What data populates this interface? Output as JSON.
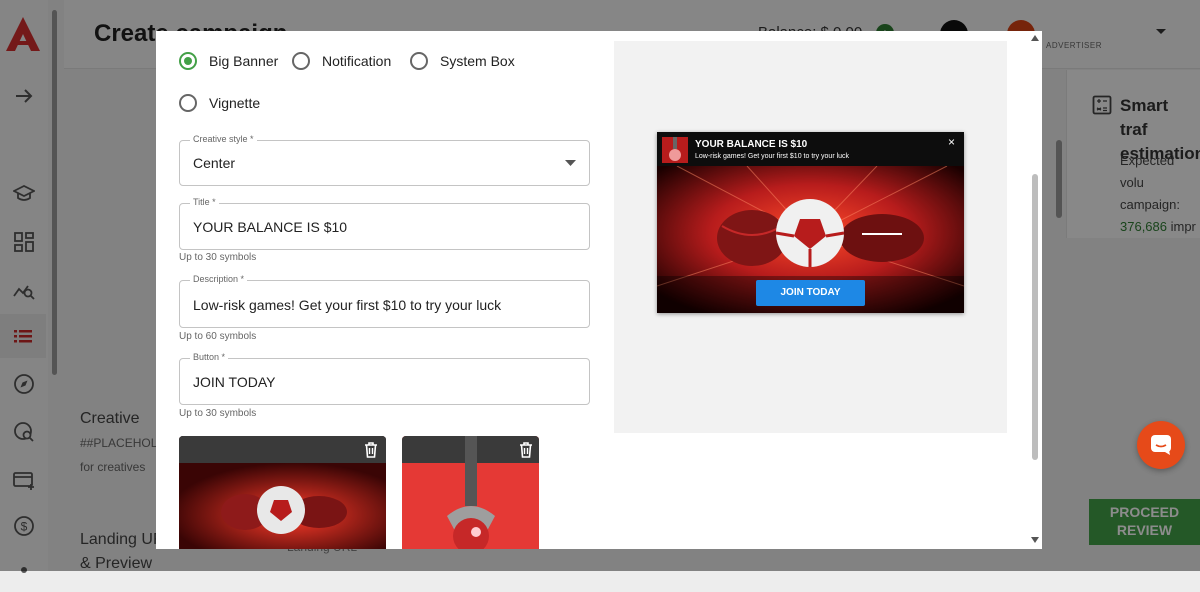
{
  "app": {
    "page_title": "Create campaign",
    "balance": "Balance: $ 0.00",
    "balance_add": "+",
    "account_role": "ADVERTISER"
  },
  "background": {
    "creative_label": "Creative",
    "placeholder_text": "##PLACEHOLI",
    "for_creatives": "for creatives",
    "landing_label": "Landing UR",
    "landing_label2": "& Preview",
    "landing_field": "Landing URL",
    "smart_title": "Smart traf estimation",
    "smart_text": "Expected volu campaign:",
    "smart_number": "376,686",
    "smart_suffix": " impr",
    "proceed_button": "PROCEED REVIEW"
  },
  "modal": {
    "format_options": [
      {
        "label": "Big Banner",
        "selected": true
      },
      {
        "label": "Notification",
        "selected": false
      },
      {
        "label": "System Box",
        "selected": false
      },
      {
        "label": "Vignette",
        "selected": false
      }
    ],
    "creative_style": {
      "label": "Creative style *",
      "value": "Center"
    },
    "title": {
      "label": "Title *",
      "value": "YOUR BALANCE IS $10",
      "helper": "Up to 30 symbols"
    },
    "description": {
      "label": "Description *",
      "value": "Low-risk games! Get your first $10 to try your luck",
      "helper": "Up to 60 symbols"
    },
    "button": {
      "label": "Button *",
      "value": "JOIN TODAY",
      "helper": "Up to 30 symbols"
    }
  },
  "preview": {
    "title": "YOUR BALANCE IS $10",
    "description": "Low-risk games! Get your first $10 to try your luck",
    "button": "JOIN TODAY",
    "close": "×"
  },
  "colors": {
    "accent_green": "#43a047",
    "brand_red": "#d32f2f",
    "button_blue": "#1e88e5"
  }
}
